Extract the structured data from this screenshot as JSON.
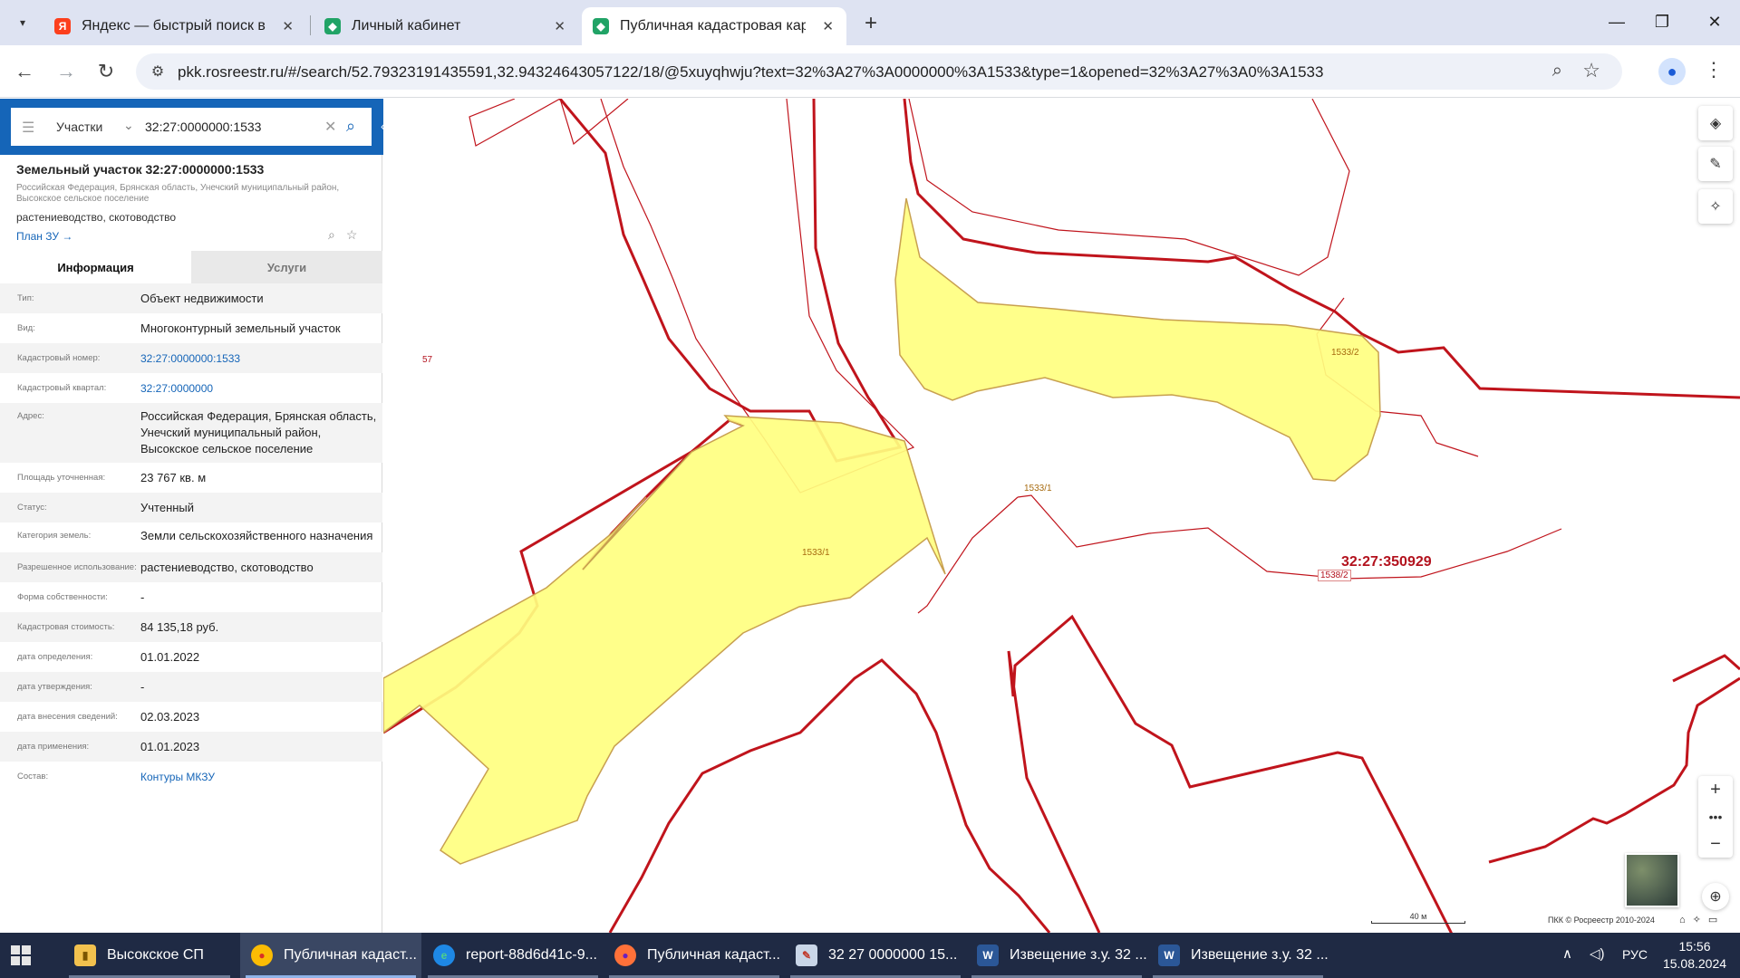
{
  "browser": {
    "tabs": [
      {
        "title": "Яндекс — быстрый поиск в ин",
        "icon": "yandex-icon"
      },
      {
        "title": "Личный кабинет",
        "icon": "rosreestr-icon"
      },
      {
        "title": "Публичная кадастровая карта",
        "icon": "rosreestr-icon",
        "active": true
      }
    ],
    "url": "pkk.rosreestr.ru/#/search/52.79323191435591,32.94324643057122/18/@5xuyqhwju?text=32%3A27%3A0000000%3A1533&type=1&opened=32%3A27%3A0%3A1533"
  },
  "search": {
    "type_label": "Участки",
    "query": "32:27:0000000:1533"
  },
  "object": {
    "title": "Земельный участок 32:27:0000000:1533",
    "region": "Российская Федерация, Брянская область, Унечский муниципальный район, Высокское сельское поселение",
    "use": "растениеводство, скотоводство",
    "plan_link": "План ЗУ →",
    "tabs": {
      "info": "Информация",
      "services": "Услуги"
    },
    "rows": [
      {
        "k": "Тип:",
        "v": "Объект недвижимости"
      },
      {
        "k": "Вид:",
        "v": "Многоконтурный земельный участок"
      },
      {
        "k": "Кадастровый номер:",
        "v": "32:27:0000000:1533",
        "link": true
      },
      {
        "k": "Кадастровый квартал:",
        "v": "32:27:0000000",
        "link": true
      },
      {
        "k": "Адрес:",
        "v": "Российская Федерация, Брянская область, Унечский муниципальный район, Высокское сельское поселение"
      },
      {
        "k": "Площадь уточненная:",
        "v": "23 767 кв. м"
      },
      {
        "k": "Статус:",
        "v": "Учтенный"
      },
      {
        "k": "Категория земель:",
        "v": "Земли сельскохозяйственного назначения"
      },
      {
        "k": "Разрешенное использование:",
        "v": "растениеводство, скотоводство"
      },
      {
        "k": "Форма собственности:",
        "v": "-"
      },
      {
        "k": "Кадастровая стоимость:",
        "v": "84 135,18 руб."
      },
      {
        "k": "дата определения:",
        "v": "01.01.2022"
      },
      {
        "k": "дата утверждения:",
        "v": "-"
      },
      {
        "k": "дата внесения сведений:",
        "v": "02.03.2023"
      },
      {
        "k": "дата применения:",
        "v": "01.01.2023"
      },
      {
        "k": "Состав:",
        "v": "Контуры МКЗУ",
        "link": true
      }
    ]
  },
  "map": {
    "labels": {
      "contour_a": "1533/1",
      "contour_b": "1533/1",
      "contour_c": "1533/2",
      "quarter": "32:27:350929",
      "parcel_1538": "1538/2",
      "num_57": "57"
    },
    "scale": "40 м",
    "copyright": "ПКК © Росреестр 2010-2024",
    "colors": {
      "parcel_fill": "#ffff80",
      "parcel_stroke": "#c8a050",
      "boundary": "#c0141c"
    }
  },
  "taskbar": {
    "items": [
      {
        "label": "Высокское СП",
        "icon": "folder-icon"
      },
      {
        "label": "Публичная кадаст...",
        "icon": "chrome-icon",
        "active": true
      },
      {
        "label": "report-88d6d41c-9...",
        "icon": "edge-icon"
      },
      {
        "label": "Публичная кадаст...",
        "icon": "firefox-icon"
      },
      {
        "label": "32  27  0000000  15...",
        "icon": "paint-icon"
      },
      {
        "label": "Извещение з.у. 32 ...",
        "icon": "word-icon"
      },
      {
        "label": "Извещение з.у. 32 ...",
        "icon": "word-icon"
      }
    ],
    "lang": "РУС",
    "time": "15:56",
    "date": "15.08.2024"
  }
}
